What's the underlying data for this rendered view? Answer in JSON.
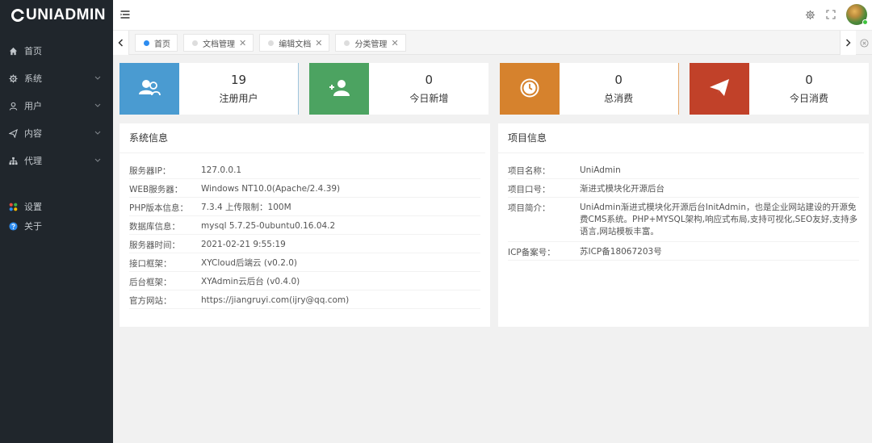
{
  "app": {
    "logo": "UNIADMIN"
  },
  "sidebar": {
    "items": [
      {
        "label": "首页",
        "icon": "home-icon",
        "has_children": false
      },
      {
        "label": "系统",
        "icon": "gear-icon",
        "has_children": true
      },
      {
        "label": "用户",
        "icon": "user-icon",
        "has_children": true
      },
      {
        "label": "内容",
        "icon": "send-icon",
        "has_children": true
      },
      {
        "label": "代理",
        "icon": "sitemap-icon",
        "has_children": true
      }
    ],
    "bottom_items": [
      {
        "label": "设置",
        "icon": "apps-icon"
      },
      {
        "label": "关于",
        "icon": "question-icon"
      }
    ]
  },
  "tabs": [
    {
      "label": "首页",
      "active": true,
      "closable": false
    },
    {
      "label": "文档管理",
      "active": false,
      "closable": true
    },
    {
      "label": "编辑文档",
      "active": false,
      "closable": true
    },
    {
      "label": "分类管理",
      "active": false,
      "closable": true
    }
  ],
  "stats": [
    {
      "value": "19",
      "label": "注册用户",
      "color": "#4a9bd1",
      "icon": "users-icon"
    },
    {
      "value": "0",
      "label": "今日新增",
      "color": "#4ca361",
      "icon": "add-user-icon"
    },
    {
      "value": "0",
      "label": "总消费",
      "color": "#d6822d",
      "icon": "clock-icon"
    },
    {
      "value": "0",
      "label": "今日消费",
      "color": "#c14129",
      "icon": "paper-plane-icon"
    }
  ],
  "system_info": {
    "title": "系统信息",
    "rows": [
      {
        "key": "服务器IP：",
        "value": "127.0.0.1"
      },
      {
        "key": "WEB服务器：",
        "value": "Windows NT10.0(Apache/2.4.39)"
      },
      {
        "key": "PHP版本信息：",
        "value": "7.3.4 上传限制：100M"
      },
      {
        "key": "数据库信息：",
        "value": "mysql 5.7.25-0ubuntu0.16.04.2"
      },
      {
        "key": "服务器时间：",
        "value": "2021-02-21 9:55:19"
      },
      {
        "key": "接口框架：",
        "value": "XYCloud后端云 (v0.2.0)"
      },
      {
        "key": "后台框架：",
        "value": "XYAdmin云后台 (v0.4.0)"
      },
      {
        "key": "官方网站：",
        "value": "https://jiangruyi.com(ijry@qq.com)"
      }
    ]
  },
  "project_info": {
    "title": "项目信息",
    "rows": [
      {
        "key": "项目名称：",
        "value": "UniAdmin"
      },
      {
        "key": "项目口号：",
        "value": "渐进式模块化开源后台"
      },
      {
        "key": "项目简介：",
        "value": "UniAdmin渐进式模块化开源后台InitAdmin，也是企业网站建设的开源免费CMS系统。PHP+MYSQL架构,响应式布局,支持可视化,SEO友好,支持多语言,网站模板丰富。"
      },
      {
        "key": "ICP备案号：",
        "value": "苏ICP备18067203号"
      }
    ]
  }
}
